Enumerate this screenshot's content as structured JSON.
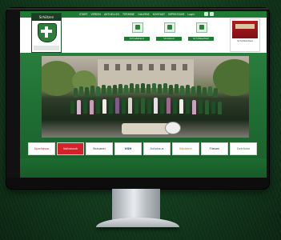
{
  "website": {
    "logo_text": "Schützen",
    "nav_items": [
      "START",
      "VEREIN",
      "AKTUELLES",
      "TERMINE",
      "GALERIE",
      "KONTAKT",
      "IMPRESSUM"
    ],
    "login_label": "Login",
    "features": [
      {
        "label": "Schießstand"
      },
      {
        "label": "Vorstand"
      },
      {
        "label": "Schützenfest"
      }
    ],
    "event_box": {
      "caption": "Schützenfest"
    },
    "photo_credit": "",
    "sponsors": [
      {
        "label": "Sparkasse",
        "text_color": "#c8102e"
      },
      {
        "label": "Volksbank",
        "text_color": "#ffffff",
        "bg": "#d4212b"
      },
      {
        "label": "Brauerei",
        "text_color": "#2b2b2b"
      },
      {
        "label": "VGH",
        "text_color": "#1a4b8c"
      },
      {
        "label": "Autohaus",
        "text_color": "#1a4b8c"
      },
      {
        "label": "Bäckerei",
        "text_color": "#b67a1a"
      },
      {
        "label": "Fliesen",
        "text_color": "#222222"
      },
      {
        "label": "Getränke",
        "text_color": "#2f7f3e"
      }
    ],
    "colors": {
      "brand_green": "#1f7a34",
      "header_bg": "#ffffff",
      "screen_bg": "#2f8a45"
    }
  },
  "device": {
    "type": "desktop-monitor",
    "icons": [
      "screen",
      "stand"
    ]
  }
}
